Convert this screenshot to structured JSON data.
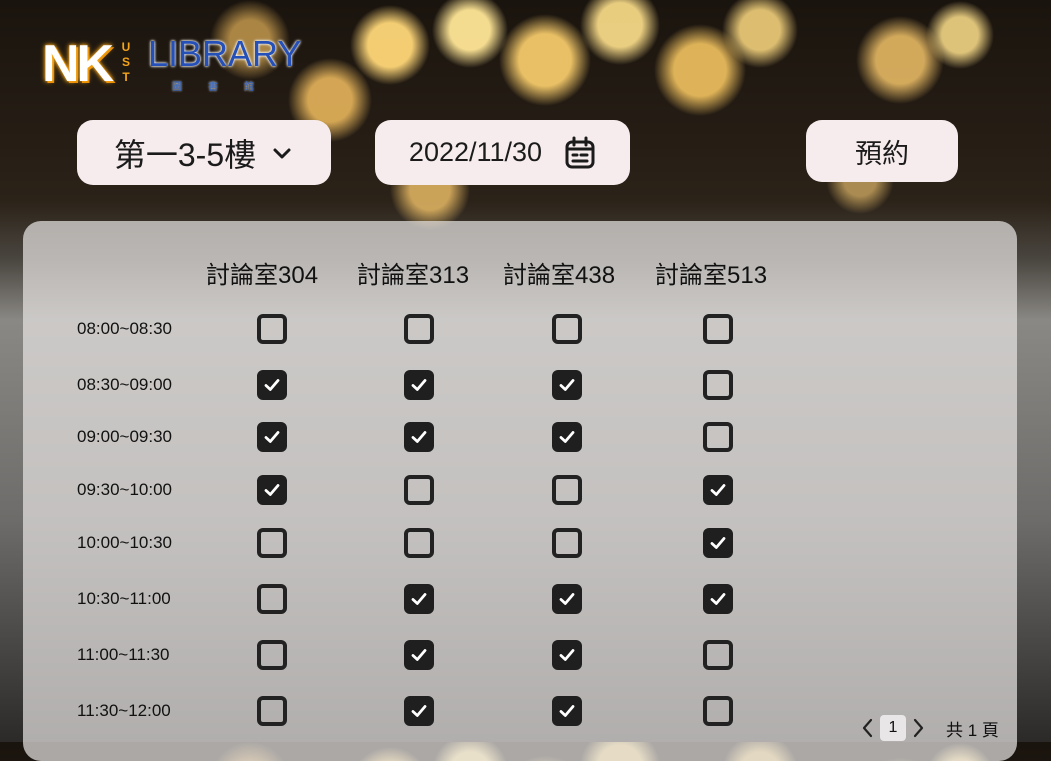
{
  "logo": {
    "nk": "NK",
    "ust": [
      "U",
      "S",
      "T"
    ],
    "library": "LIBRARY",
    "chinese": "圖書館"
  },
  "toolbar": {
    "floor": "第一3-5樓",
    "date": "2022/11/30",
    "reserve_label": "預約"
  },
  "rooms": [
    "討論室304",
    "討論室313",
    "討論室438",
    "討論室513"
  ],
  "slots": [
    {
      "time": "08:00~08:30",
      "checked": [
        false,
        false,
        false,
        false
      ]
    },
    {
      "time": "08:30~09:00",
      "checked": [
        true,
        true,
        true,
        false
      ]
    },
    {
      "time": "09:00~09:30",
      "checked": [
        true,
        true,
        true,
        false
      ]
    },
    {
      "time": "09:30~10:00",
      "checked": [
        true,
        false,
        false,
        true
      ]
    },
    {
      "time": "10:00~10:30",
      "checked": [
        false,
        false,
        false,
        true
      ]
    },
    {
      "time": "10:30~11:00",
      "checked": [
        false,
        true,
        true,
        true
      ]
    },
    {
      "time": "11:00~11:30",
      "checked": [
        false,
        true,
        true,
        false
      ]
    },
    {
      "time": "11:30~12:00",
      "checked": [
        false,
        true,
        true,
        false
      ]
    }
  ],
  "pagination": {
    "current": "1",
    "total": "共 1 頁"
  },
  "colors": {
    "pill_bg": "#f6ecee",
    "checkbox": "#1f1f1f",
    "logo_orange": "#f4a41a",
    "logo_blue": "#2550b8"
  }
}
